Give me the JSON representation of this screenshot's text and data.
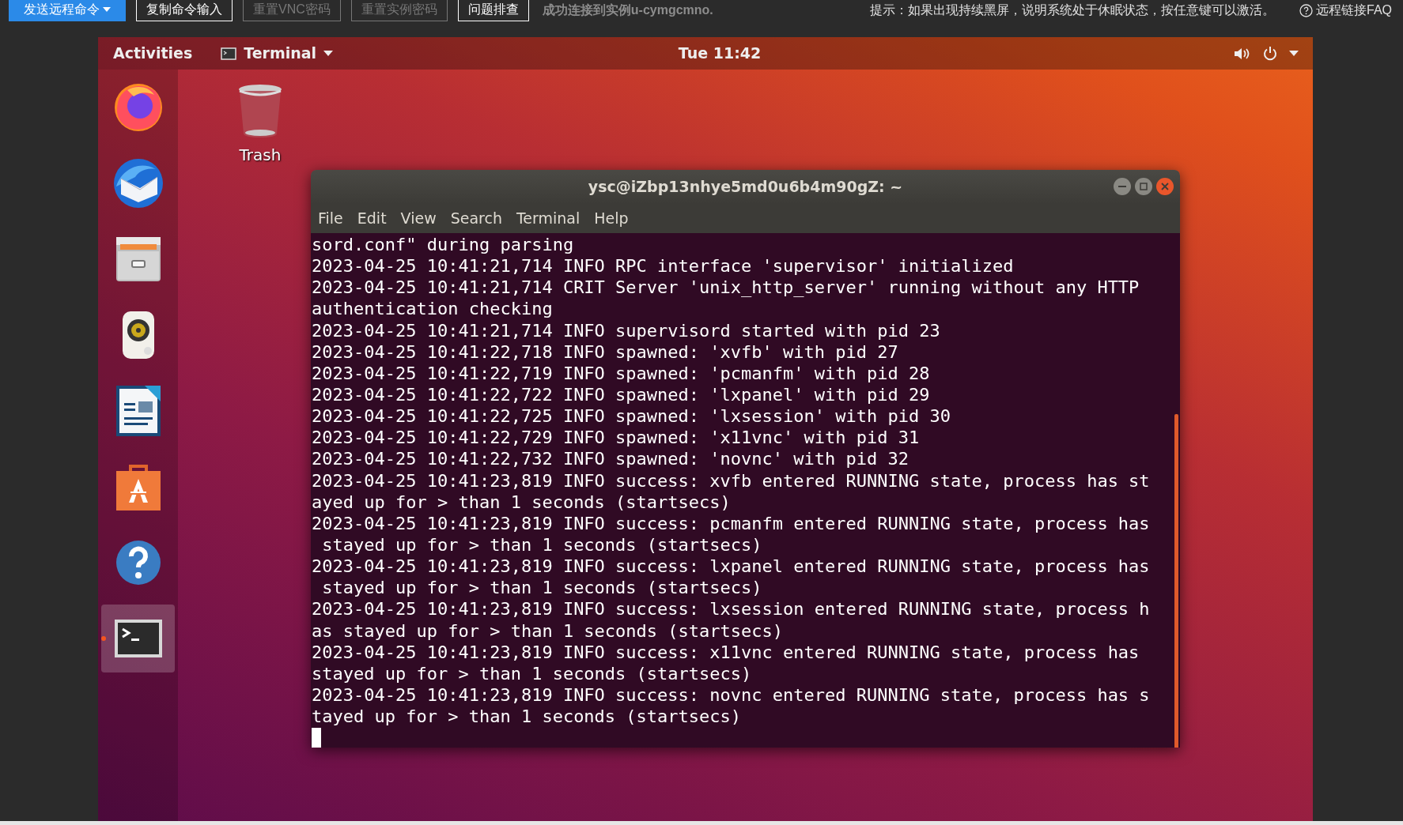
{
  "toolbar": {
    "buttons": [
      {
        "label": "发送远程命令",
        "primary": true,
        "disabled": false,
        "dropdown": true
      },
      {
        "label": "复制命令输入",
        "primary": false,
        "disabled": false,
        "dropdown": false
      },
      {
        "label": "重置VNC密码",
        "primary": false,
        "disabled": true,
        "dropdown": false
      },
      {
        "label": "重置实例密码",
        "primary": false,
        "disabled": true,
        "dropdown": false
      },
      {
        "label": "问题排查",
        "primary": false,
        "disabled": false,
        "dropdown": false
      }
    ],
    "status": "成功连接到实例u-cymgcmno.",
    "hint": "提示：如果出现持续黑屏，说明系统处于休眠状态，按任意键可以激活。",
    "faq_link": "远程链接FAQ"
  },
  "top_panel": {
    "activities": "Activities",
    "app_menu": "Terminal",
    "clock": "Tue 11:42"
  },
  "dock": [
    {
      "kind": "firefox",
      "running": false
    },
    {
      "kind": "thunderbird",
      "running": false
    },
    {
      "kind": "files",
      "running": false
    },
    {
      "kind": "rhythmbox",
      "running": false
    },
    {
      "kind": "writer",
      "running": false
    },
    {
      "kind": "software",
      "running": false
    },
    {
      "kind": "help",
      "running": false
    },
    {
      "kind": "terminal",
      "running": true
    }
  ],
  "desktop_icons": [
    {
      "label": "Trash"
    }
  ],
  "terminal_window": {
    "title": "ysc@iZbp13nhye5md0u6b4m90gZ: ~",
    "menu": [
      "File",
      "Edit",
      "View",
      "Search",
      "Terminal",
      "Help"
    ],
    "lines": [
      "sord.conf\" during parsing",
      "2023-04-25 10:41:21,714 INFO RPC interface 'supervisor' initialized",
      "2023-04-25 10:41:21,714 CRIT Server 'unix_http_server' running without any HTTP",
      "authentication checking",
      "2023-04-25 10:41:21,714 INFO supervisord started with pid 23",
      "2023-04-25 10:41:22,718 INFO spawned: 'xvfb' with pid 27",
      "2023-04-25 10:41:22,719 INFO spawned: 'pcmanfm' with pid 28",
      "2023-04-25 10:41:22,722 INFO spawned: 'lxpanel' with pid 29",
      "2023-04-25 10:41:22,725 INFO spawned: 'lxsession' with pid 30",
      "2023-04-25 10:41:22,729 INFO spawned: 'x11vnc' with pid 31",
      "2023-04-25 10:41:22,732 INFO spawned: 'novnc' with pid 32",
      "2023-04-25 10:41:23,819 INFO success: xvfb entered RUNNING state, process has st",
      "ayed up for > than 1 seconds (startsecs)",
      "2023-04-25 10:41:23,819 INFO success: pcmanfm entered RUNNING state, process has",
      " stayed up for > than 1 seconds (startsecs)",
      "2023-04-25 10:41:23,819 INFO success: lxpanel entered RUNNING state, process has",
      " stayed up for > than 1 seconds (startsecs)",
      "2023-04-25 10:41:23,819 INFO success: lxsession entered RUNNING state, process h",
      "as stayed up for > than 1 seconds (startsecs)",
      "2023-04-25 10:41:23,819 INFO success: x11vnc entered RUNNING state, process has",
      "stayed up for > than 1 seconds (startsecs)",
      "2023-04-25 10:41:23,819 INFO success: novnc entered RUNNING state, process has s",
      "tayed up for > than 1 seconds (startsecs)"
    ]
  }
}
